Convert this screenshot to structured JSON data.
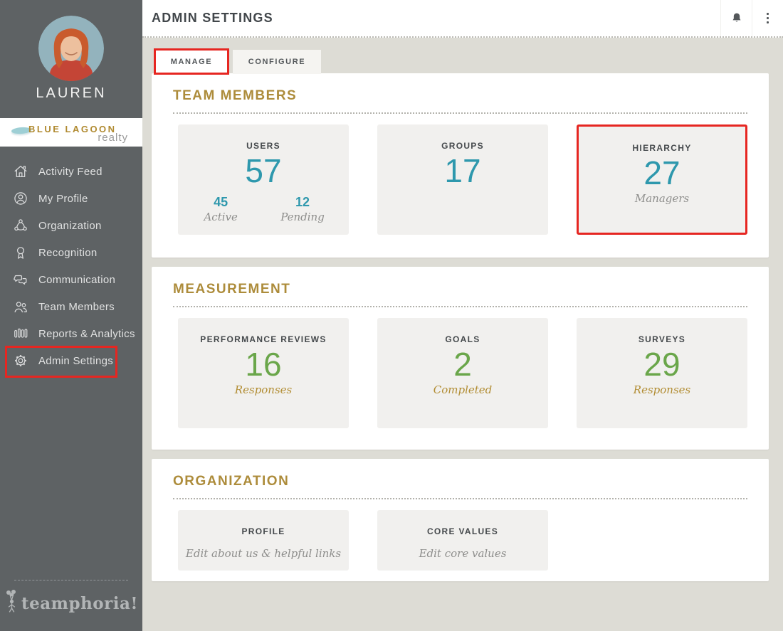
{
  "sidebar": {
    "user_name": "LAUREN",
    "brand": {
      "line1": "BLUE LAGOON",
      "line2": "realty"
    },
    "items": [
      {
        "label": "Activity Feed",
        "icon": "home-icon"
      },
      {
        "label": "My Profile",
        "icon": "profile-icon"
      },
      {
        "label": "Organization",
        "icon": "organization-icon"
      },
      {
        "label": "Recognition",
        "icon": "recognition-icon"
      },
      {
        "label": "Communication",
        "icon": "communication-icon"
      },
      {
        "label": "Team Members",
        "icon": "team-members-icon"
      },
      {
        "label": "Reports & Analytics",
        "icon": "bar-chart-icon"
      },
      {
        "label": "Admin Settings",
        "icon": "gear-icon",
        "highlighted": true
      }
    ],
    "logo_text": "teamphoria!"
  },
  "header": {
    "title": "ADMIN SETTINGS",
    "icons": [
      "bell-icon",
      "kebab-menu-icon"
    ]
  },
  "tabs": [
    {
      "label": "MANAGE",
      "active": true,
      "highlighted": true
    },
    {
      "label": "CONFIGURE",
      "active": false
    }
  ],
  "sections": [
    {
      "title": "TEAM MEMBERS",
      "cards": [
        {
          "title": "USERS",
          "value": "57",
          "stats": [
            {
              "value": "45",
              "label": "Active"
            },
            {
              "value": "12",
              "label": "Pending"
            }
          ]
        },
        {
          "title": "GROUPS",
          "value": "17"
        },
        {
          "title": "HIERARCHY",
          "value": "27",
          "sublabel": "Managers",
          "highlighted": true
        }
      ]
    },
    {
      "title": "MEASUREMENT",
      "cards": [
        {
          "title": "PERFORMANCE REVIEWS",
          "value": "16",
          "sublabel": "Responses"
        },
        {
          "title": "GOALS",
          "value": "2",
          "sublabel": "Completed"
        },
        {
          "title": "SURVEYS",
          "value": "29",
          "sublabel": "Responses"
        }
      ]
    },
    {
      "title": "ORGANIZATION",
      "cards": [
        {
          "title": "PROFILE",
          "sublabel": "Edit about us & helpful links"
        },
        {
          "title": "CORE VALUES",
          "sublabel": "Edit core values"
        }
      ]
    }
  ],
  "colors": {
    "sidebar_bg": "#5e6264",
    "content_bg": "#dddcd5",
    "section_heading_gold": "#ad8c3b",
    "value_teal": "#2e98ad",
    "value_green": "#6aa64a",
    "label_gold": "#b28d33",
    "annotation_red": "#e62621"
  }
}
